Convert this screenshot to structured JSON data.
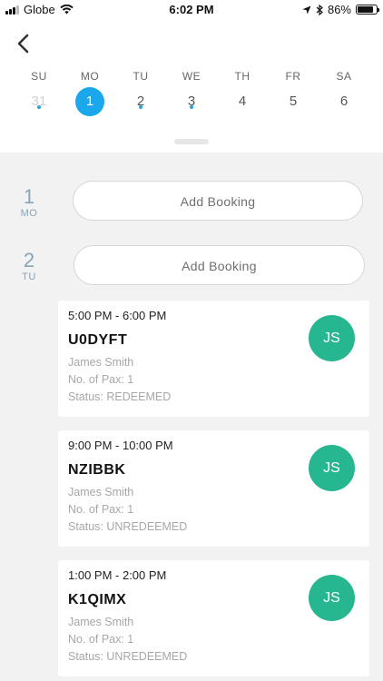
{
  "status_bar": {
    "carrier": "Globe",
    "time": "6:02 PM",
    "battery": "86%",
    "battery_level": 0.86
  },
  "week": {
    "days": [
      {
        "dow": "SU",
        "num": "31",
        "state": "past",
        "has_dot": true
      },
      {
        "dow": "MO",
        "num": "1",
        "state": "selected",
        "has_dot": false
      },
      {
        "dow": "TU",
        "num": "2",
        "state": "normal",
        "has_dot": true
      },
      {
        "dow": "WE",
        "num": "3",
        "state": "normal",
        "has_dot": true
      },
      {
        "dow": "TH",
        "num": "4",
        "state": "normal",
        "has_dot": false
      },
      {
        "dow": "FR",
        "num": "5",
        "state": "normal",
        "has_dot": false
      },
      {
        "dow": "SA",
        "num": "6",
        "state": "normal",
        "has_dot": false
      }
    ]
  },
  "dates": [
    {
      "num": "1",
      "dow": "MO",
      "add_label": "Add Booking"
    },
    {
      "num": "2",
      "dow": "TU",
      "add_label": "Add Booking"
    }
  ],
  "bookings": [
    {
      "time": "5:00 PM - 6:00 PM",
      "code": "U0DYFT",
      "name": "James Smith",
      "pax": "No. of Pax: 1",
      "status": "Status: REDEEMED",
      "initials": "JS"
    },
    {
      "time": "9:00 PM - 10:00 PM",
      "code": "NZIBBK",
      "name": "James Smith",
      "pax": "No. of Pax: 1",
      "status": "Status: UNREDEEMED",
      "initials": "JS"
    },
    {
      "time": "1:00 PM - 2:00 PM",
      "code": "K1QIMX",
      "name": "James Smith",
      "pax": "No. of Pax: 1",
      "status": "Status: UNREDEEMED",
      "initials": "JS"
    }
  ],
  "colors": {
    "accent": "#1aa7ec",
    "avatar": "#26b690",
    "dot": "#27a6d9",
    "date_label": "#8aa3b6"
  },
  "icons": [
    "back-chevron-icon",
    "signal-icon",
    "wifi-icon",
    "location-icon",
    "bluetooth-icon",
    "battery-icon"
  ]
}
